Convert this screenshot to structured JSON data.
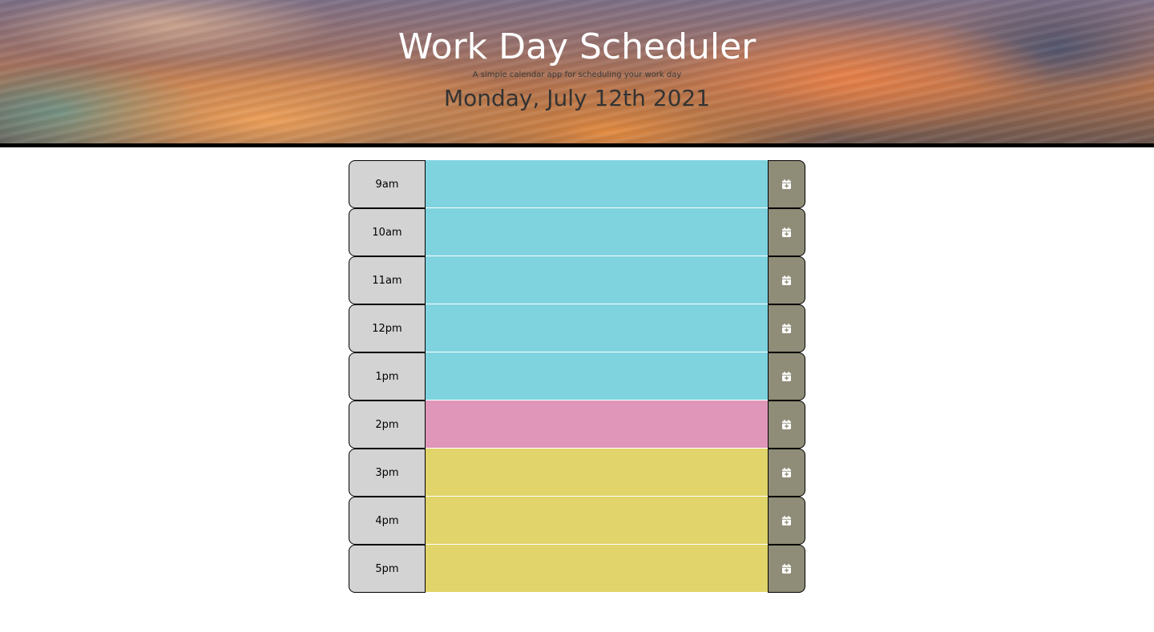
{
  "header": {
    "title": "Work Day Scheduler",
    "subtitle": "A simple calendar app for scheduling your work day",
    "current_day": "Monday, July 12th 2021"
  },
  "colors": {
    "past": "#7fd3df",
    "present": "#df96b8",
    "future": "#e0d46a",
    "hour_bg": "#d3d3d3",
    "save_bg": "#8f8c78"
  },
  "schedule": {
    "rows": [
      {
        "hour": "9am",
        "status": "past",
        "text": "",
        "save_icon": "calendar-plus-icon"
      },
      {
        "hour": "10am",
        "status": "past",
        "text": "",
        "save_icon": "calendar-plus-icon"
      },
      {
        "hour": "11am",
        "status": "past",
        "text": "",
        "save_icon": "calendar-plus-icon"
      },
      {
        "hour": "12pm",
        "status": "past",
        "text": "",
        "save_icon": "calendar-plus-icon"
      },
      {
        "hour": "1pm",
        "status": "past",
        "text": "",
        "save_icon": "calendar-plus-icon"
      },
      {
        "hour": "2pm",
        "status": "present",
        "text": "",
        "save_icon": "calendar-plus-icon"
      },
      {
        "hour": "3pm",
        "status": "future",
        "text": "",
        "save_icon": "calendar-plus-icon"
      },
      {
        "hour": "4pm",
        "status": "future",
        "text": "",
        "save_icon": "calendar-plus-icon"
      },
      {
        "hour": "5pm",
        "status": "future",
        "text": "",
        "save_icon": "calendar-plus-icon"
      }
    ]
  }
}
